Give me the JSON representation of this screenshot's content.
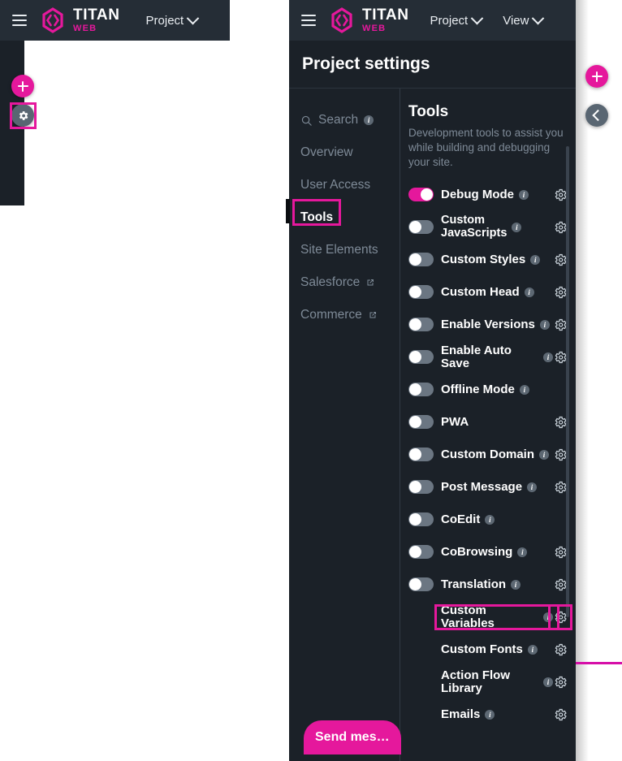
{
  "background_app": {
    "topbar": {
      "menu_icon": "hamburger-icon",
      "logo_primary": "TITAN",
      "logo_secondary": "WEB",
      "project_menu": "Project"
    },
    "sidebar": {
      "add_icon": "plus-icon",
      "settings_icon": "gear-icon"
    }
  },
  "panel": {
    "topbar": {
      "menu_icon": "hamburger-icon",
      "logo_primary": "TITAN",
      "logo_secondary": "WEB",
      "project_menu": "Project",
      "view_menu": "View"
    },
    "title": "Project settings",
    "nav": {
      "items": [
        {
          "label": "Search",
          "icon": "search-icon",
          "info": true,
          "external": false,
          "active": false
        },
        {
          "label": "Overview",
          "icon": null,
          "info": false,
          "external": false,
          "active": false
        },
        {
          "label": "User Access",
          "icon": null,
          "info": false,
          "external": false,
          "active": false
        },
        {
          "label": "Tools",
          "icon": null,
          "info": false,
          "external": false,
          "active": true
        },
        {
          "label": "Site Elements",
          "icon": null,
          "info": false,
          "external": false,
          "active": false
        },
        {
          "label": "Salesforce",
          "icon": null,
          "info": false,
          "external": true,
          "active": false
        },
        {
          "label": "Commerce",
          "icon": null,
          "info": false,
          "external": true,
          "active": false
        }
      ]
    },
    "content": {
      "heading": "Tools",
      "description": "Development tools to assist you while building and debugging your site.",
      "rows": [
        {
          "label": "Debug Mode",
          "toggle": "on",
          "info": true,
          "gear": true
        },
        {
          "label": "Custom JavaScripts",
          "toggle": "off",
          "info": true,
          "gear": true
        },
        {
          "label": "Custom Styles",
          "toggle": "off",
          "info": true,
          "gear": true
        },
        {
          "label": "Custom Head",
          "toggle": "off",
          "info": true,
          "gear": true
        },
        {
          "label": "Enable Versions",
          "toggle": "off",
          "info": true,
          "gear": true
        },
        {
          "label": "Enable Auto Save",
          "toggle": "off",
          "info": true,
          "gear": true
        },
        {
          "label": "Offline Mode",
          "toggle": "off",
          "info": true,
          "gear": false
        },
        {
          "label": "PWA",
          "toggle": "off",
          "info": false,
          "gear": true
        },
        {
          "label": "Custom Domain",
          "toggle": "off",
          "info": true,
          "gear": true
        },
        {
          "label": "Post Message",
          "toggle": "off",
          "info": true,
          "gear": true
        },
        {
          "label": "CoEdit",
          "toggle": "off",
          "info": true,
          "gear": false
        },
        {
          "label": "CoBrowsing",
          "toggle": "off",
          "info": true,
          "gear": true
        },
        {
          "label": "Translation",
          "toggle": "off",
          "info": true,
          "gear": true
        },
        {
          "label": "Custom Variables",
          "toggle": "none",
          "info": true,
          "gear": true
        },
        {
          "label": "Custom Fonts",
          "toggle": "none",
          "info": true,
          "gear": true
        },
        {
          "label": "Action Flow Library",
          "toggle": "none",
          "info": true,
          "gear": true
        },
        {
          "label": "Emails",
          "toggle": "none",
          "info": true,
          "gear": true
        }
      ]
    },
    "add_button_icon": "plus-icon",
    "collapse_button_icon": "chevron-left-icon",
    "send_message_button": "Send mes…"
  },
  "highlights": {
    "color": "#e5189c",
    "targets": [
      "sidebar-settings-gear",
      "nav-item-tools",
      "row-custom-variables-label",
      "row-custom-variables-gear"
    ]
  },
  "colors": {
    "accent": "#e5189c",
    "panel_bg": "#1b2128",
    "topbar_bg": "#252d36",
    "text_primary": "#ffffff",
    "text_muted": "#7e8a97",
    "toggle_off": "#6b7682"
  }
}
